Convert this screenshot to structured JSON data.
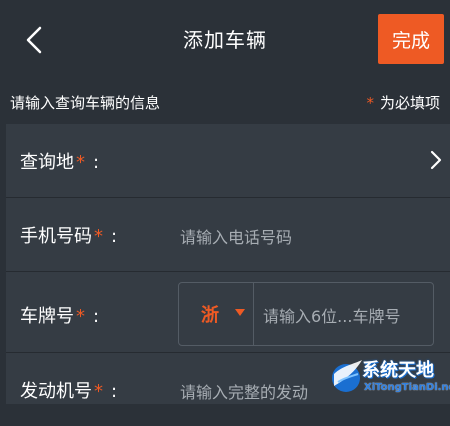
{
  "header": {
    "title": "添加车辆",
    "done_label": "完成"
  },
  "hint": {
    "left": "请输入查询车辆的信息",
    "star": "*",
    "right": "为必填项"
  },
  "form": {
    "location": {
      "label": "查询地",
      "req": "*",
      "colon": ":"
    },
    "phone": {
      "label": "手机号码",
      "req": "*",
      "colon": ":",
      "placeholder": "请输入电话号码"
    },
    "plate": {
      "label": "车牌号",
      "req": "*",
      "colon": ":",
      "province": "浙",
      "placeholder": "请输入6位...车牌号"
    },
    "engine": {
      "label": "发动机号",
      "req": "*",
      "colon": ":",
      "placeholder": "请输入完整的发动"
    }
  },
  "watermark": {
    "cn": "系统天地",
    "en": "XiTongTianDi.net"
  },
  "colors": {
    "accent": "#ee5a24",
    "background": "#2b3138",
    "panel": "#353c44"
  }
}
